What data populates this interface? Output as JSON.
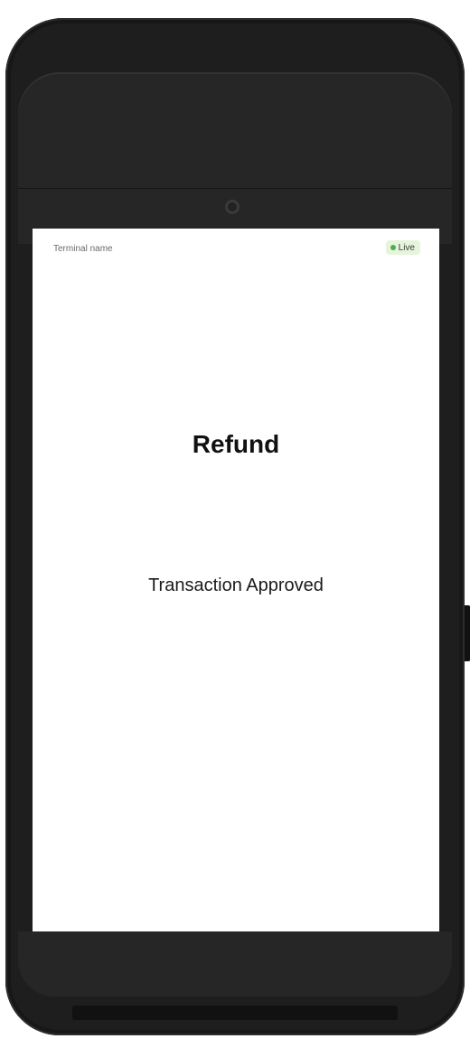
{
  "status_bar": {
    "terminal_name": "Terminal name",
    "mode_badge": "Live",
    "mode_color": "#4caf50"
  },
  "main": {
    "title": "Refund",
    "status_message": "Transaction Approved"
  }
}
